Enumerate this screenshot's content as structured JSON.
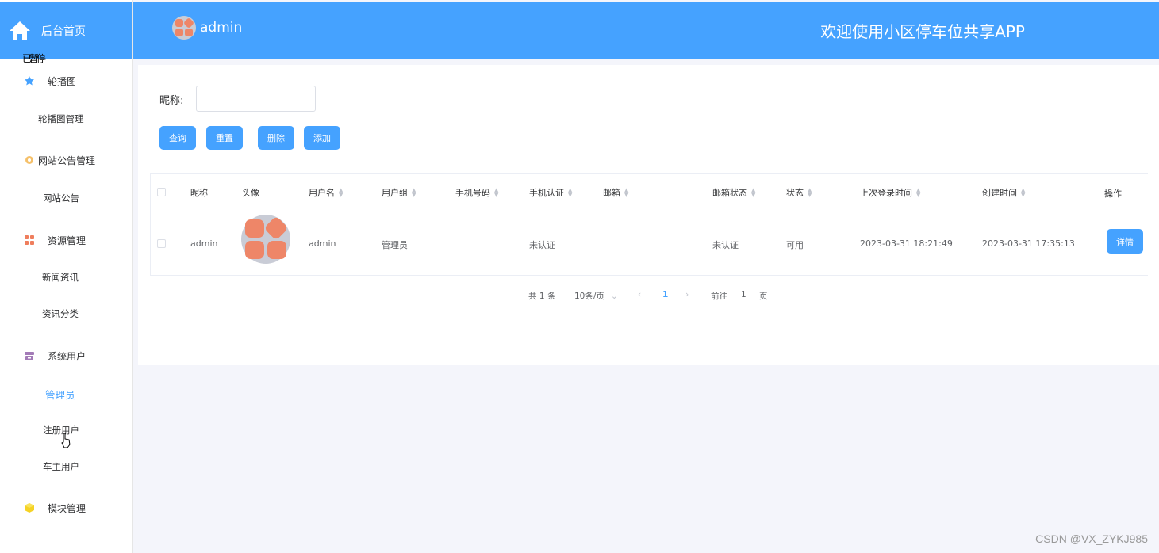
{
  "sidebar": {
    "home_label": "后台首页",
    "overlap_text": "已暂停",
    "groups": [
      {
        "label": "轮播图",
        "icon": "star-icon",
        "color": "#45a2ff"
      },
      {
        "label": "网站公告管理",
        "icon": "gear-icon",
        "color": "#f5c06a"
      },
      {
        "label": "资源管理",
        "icon": "grid-icon",
        "color": "#ef7e5d"
      },
      {
        "label": "系统用户",
        "icon": "box-icon",
        "color": "#a37bb7"
      },
      {
        "label": "模块管理",
        "icon": "cube-icon",
        "color": "#f5d224"
      }
    ],
    "subs": {
      "carousel_manage": "轮播图管理",
      "site_notice": "网站公告",
      "news": "新闻资讯",
      "news_category": "资讯分类",
      "admin": "管理员",
      "registered_users": "注册用户",
      "car_owners": "车主用户"
    }
  },
  "header": {
    "username": "admin",
    "title": "欢迎使用小区停车位共享APP"
  },
  "search": {
    "label": "昵称:",
    "placeholder": "",
    "value": ""
  },
  "buttons": {
    "query": "查询",
    "reset": "重置",
    "delete": "删除",
    "add": "添加"
  },
  "table": {
    "headers": {
      "nickname": "昵称",
      "avatar": "头像",
      "username": "用户名",
      "user_group": "用户组",
      "phone": "手机号码",
      "phone_verified": "手机认证",
      "email": "邮箱",
      "email_status": "邮箱状态",
      "status": "状态",
      "last_login": "上次登录时间",
      "created": "创建时间",
      "actions": "操作"
    },
    "rows": [
      {
        "nickname": "admin",
        "username": "admin",
        "user_group": "管理员",
        "phone": "",
        "phone_verified": "未认证",
        "email": "",
        "email_status": "未认证",
        "status": "可用",
        "last_login": "2023-03-31 18:21:49",
        "created": "2023-03-31 17:35:13",
        "action_label": "详情"
      }
    ]
  },
  "pagination": {
    "total": "共 1 条",
    "page_size": "10条/页",
    "current_page": "1",
    "goto_label": "前往",
    "goto_value": "1",
    "page_suffix": "页"
  },
  "watermark": "CSDN @VX_ZYKJ985",
  "colors": {
    "primary": "#45a2ff",
    "avatar_fill": "#ee8668",
    "avatar_bg": "#c9ccd6"
  }
}
